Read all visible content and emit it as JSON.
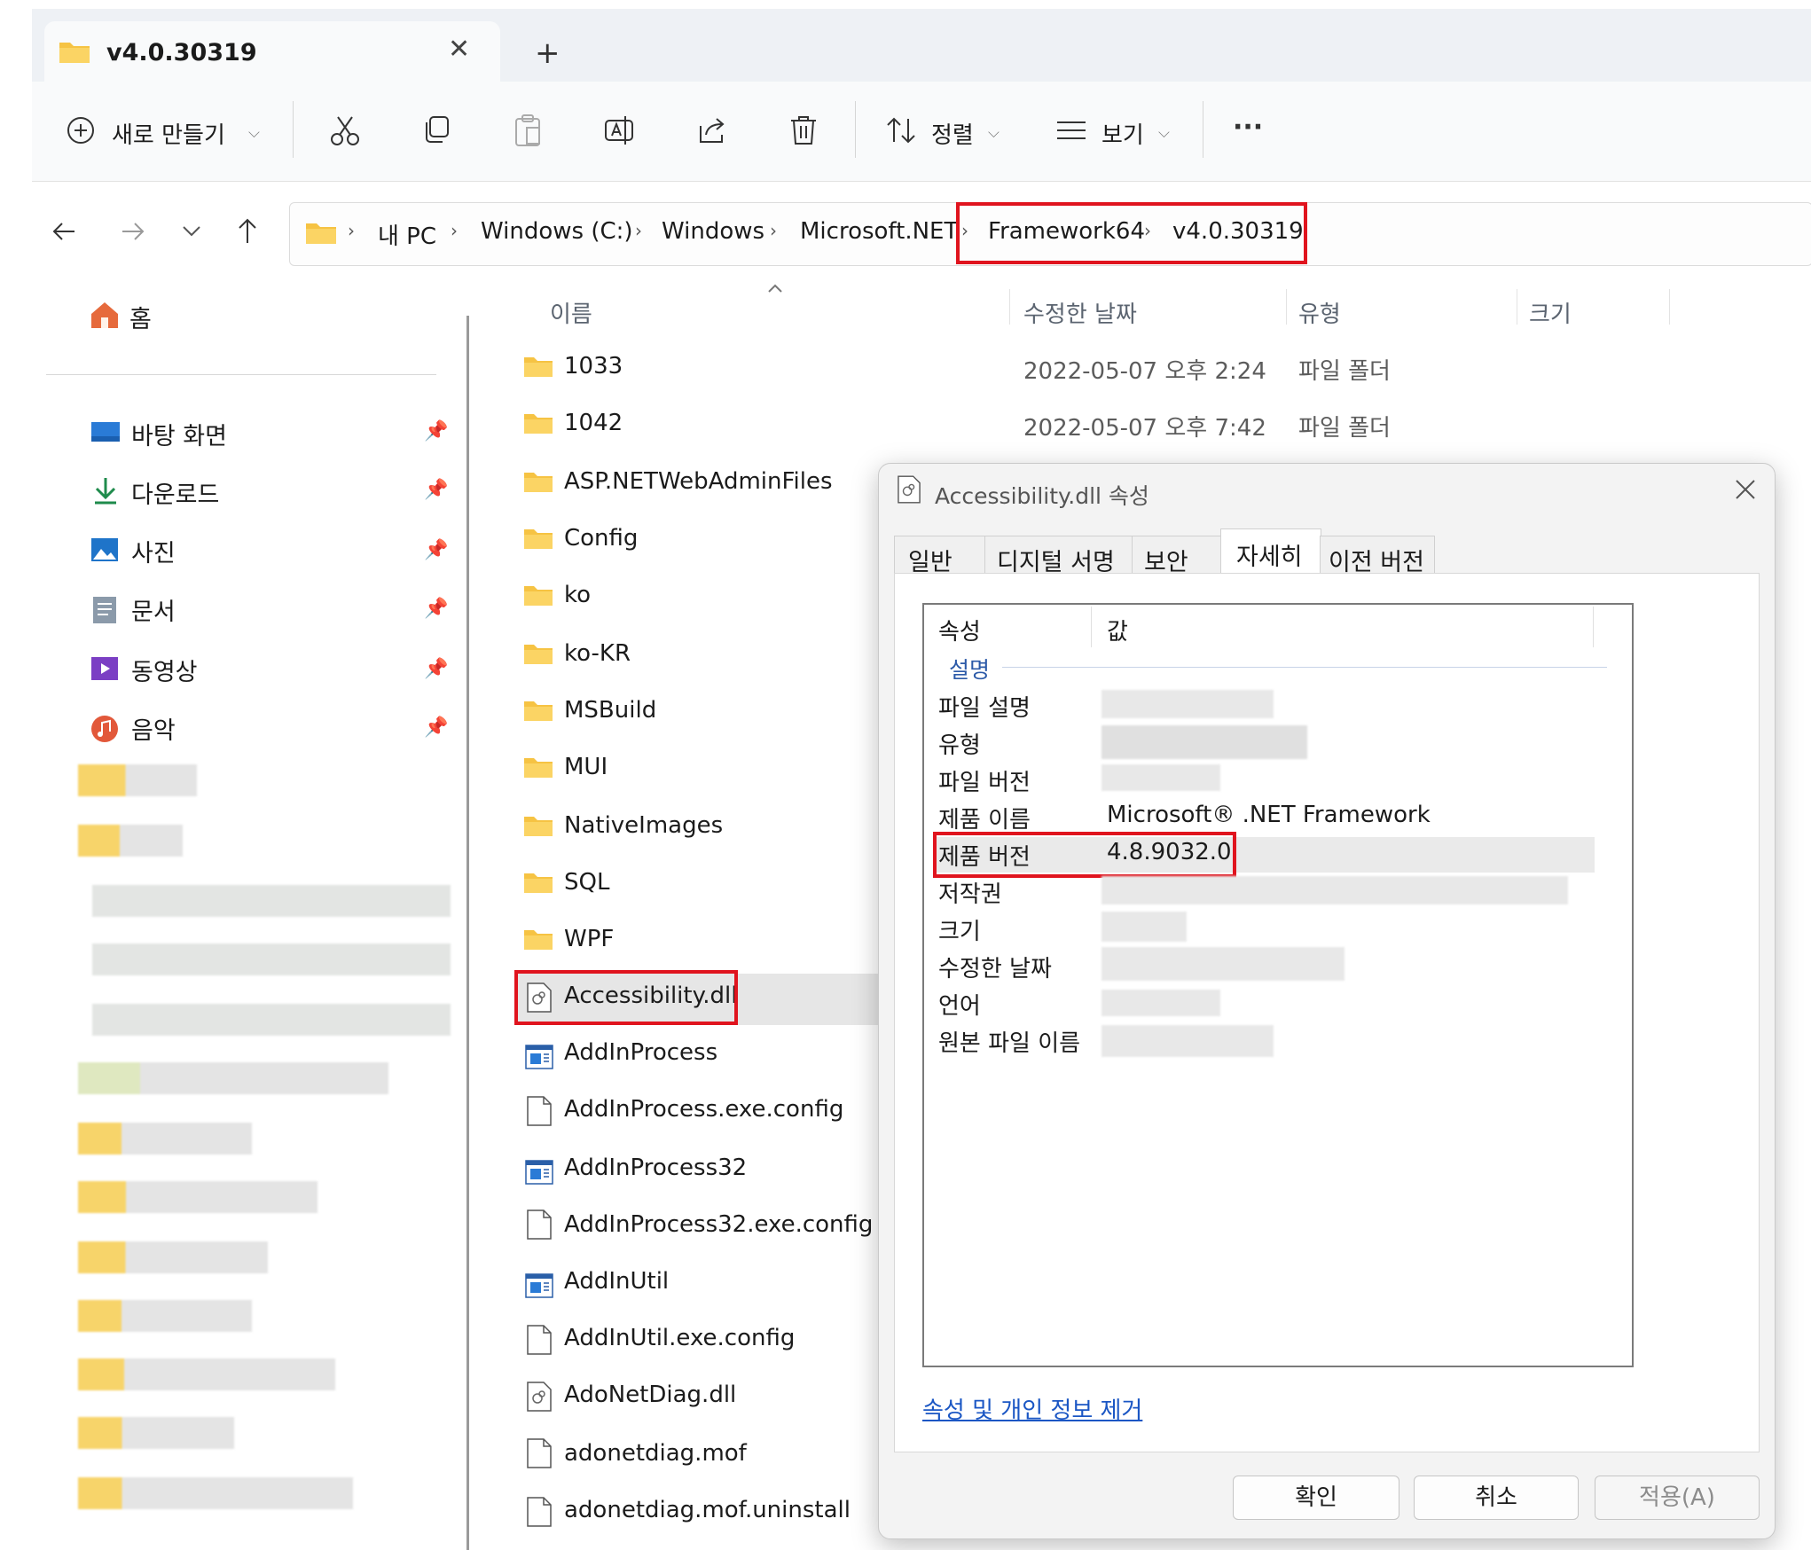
{
  "tab": {
    "title": "v4.0.30319",
    "close": "✕",
    "new": "+"
  },
  "toolbar": {
    "new_label": "새로 만들기",
    "sort_label": "정렬",
    "view_label": "보기",
    "more_label": "···"
  },
  "breadcrumb": [
    "내 PC",
    "Windows (C:)",
    "Windows",
    "Microsoft.NET",
    "Framework64",
    "v4.0.30319"
  ],
  "sidebar": {
    "home": "홈",
    "items": [
      {
        "label": "바탕 화면",
        "icon": "desktop-icon"
      },
      {
        "label": "다운로드",
        "icon": "download-icon"
      },
      {
        "label": "사진",
        "icon": "pictures-icon"
      },
      {
        "label": "문서",
        "icon": "documents-icon"
      },
      {
        "label": "동영상",
        "icon": "videos-icon"
      },
      {
        "label": "음악",
        "icon": "music-icon"
      }
    ]
  },
  "columns": {
    "name": "이름",
    "modified": "수정한 날짜",
    "type": "유형",
    "size": "크기"
  },
  "files": [
    {
      "name": "1033",
      "icon": "folder-icon",
      "modified": "2022-05-07 오후 2:24",
      "type": "파일 폴더"
    },
    {
      "name": "1042",
      "icon": "folder-icon",
      "modified": "2022-05-07 오후 7:42",
      "type": "파일 폴더"
    },
    {
      "name": "ASP.NETWebAdminFiles",
      "icon": "folder-icon"
    },
    {
      "name": "Config",
      "icon": "folder-icon"
    },
    {
      "name": "ko",
      "icon": "folder-icon"
    },
    {
      "name": "ko-KR",
      "icon": "folder-icon"
    },
    {
      "name": "MSBuild",
      "icon": "folder-icon"
    },
    {
      "name": "MUI",
      "icon": "folder-icon"
    },
    {
      "name": "NativeImages",
      "icon": "folder-icon"
    },
    {
      "name": "SQL",
      "icon": "folder-icon"
    },
    {
      "name": "WPF",
      "icon": "folder-icon"
    },
    {
      "name": "Accessibility.dll",
      "icon": "dll-file-icon"
    },
    {
      "name": "AddInProcess",
      "icon": "exe-app-icon"
    },
    {
      "name": "AddInProcess.exe.config",
      "icon": "file-icon"
    },
    {
      "name": "AddInProcess32",
      "icon": "exe-app-icon"
    },
    {
      "name": "AddInProcess32.exe.config",
      "icon": "file-icon"
    },
    {
      "name": "AddInUtil",
      "icon": "exe-app-icon"
    },
    {
      "name": "AddInUtil.exe.config",
      "icon": "file-icon"
    },
    {
      "name": "AdoNetDiag.dll",
      "icon": "dll-file-icon"
    },
    {
      "name": "adonetdiag.mof",
      "icon": "file-icon"
    },
    {
      "name": "adonetdiag.mof.uninstall",
      "icon": "file-icon"
    }
  ],
  "dialog": {
    "title": "Accessibility.dll 속성",
    "tabs": [
      "일반",
      "디지털 서명",
      "보안",
      "자세히",
      "이전 버전"
    ],
    "col_property": "속성",
    "col_value": "값",
    "section": "설명",
    "properties": [
      {
        "name": "파일 설명",
        "value": ""
      },
      {
        "name": "유형",
        "value": ""
      },
      {
        "name": "파일 버전",
        "value": ""
      },
      {
        "name": "제품 이름",
        "value": "Microsoft® .NET Framework"
      },
      {
        "name": "제품 버전",
        "value": "4.8.9032.0"
      },
      {
        "name": "저작권",
        "value": ""
      },
      {
        "name": "크기",
        "value": ""
      },
      {
        "name": "수정한 날짜",
        "value": ""
      },
      {
        "name": "언어",
        "value": ""
      },
      {
        "name": "원본 파일 이름",
        "value": ""
      }
    ],
    "remove_link": "속성 및 개인 정보 제거",
    "ok": "확인",
    "cancel": "취소",
    "apply": "적용(A)"
  },
  "colors": {
    "highlight": "#e0141e",
    "folder": "#f6c343",
    "link": "#1a56c4"
  }
}
